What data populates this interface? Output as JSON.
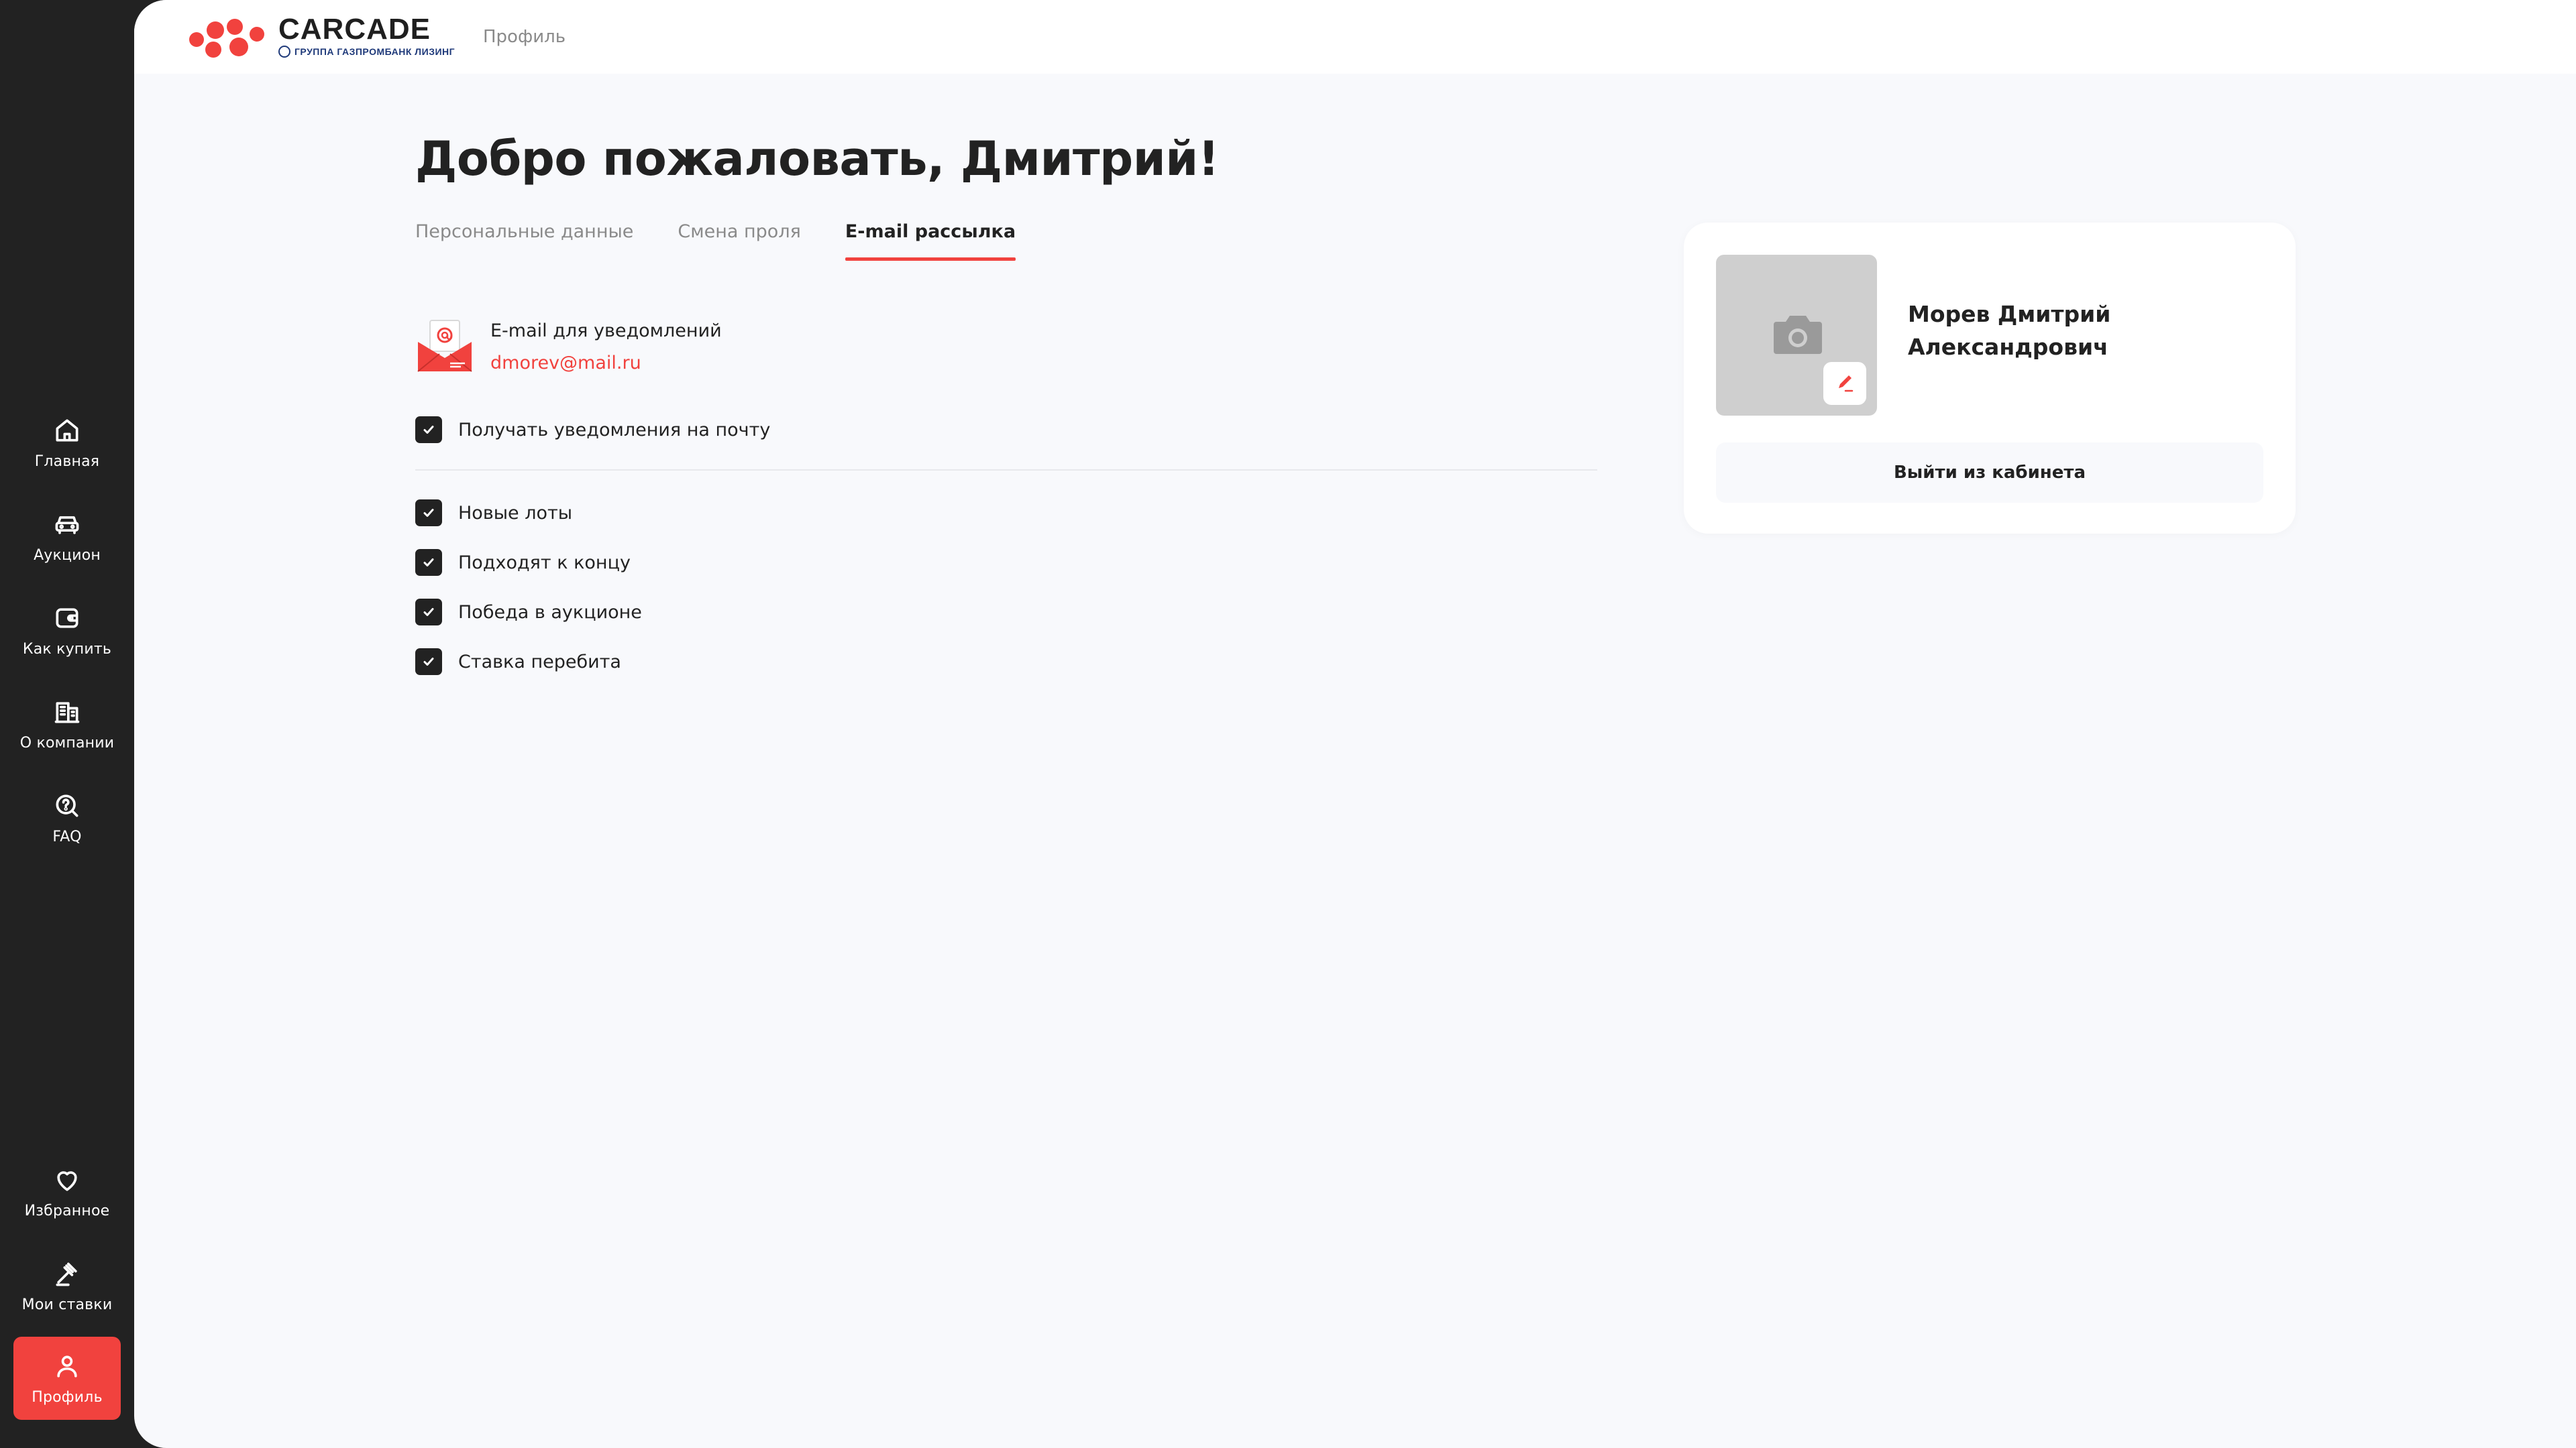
{
  "brand": {
    "name": "CARCADE",
    "subtitle": "ГРУППА ГАЗПРОМБАНК ЛИЗИНГ",
    "accent": "#F1423E",
    "dark": "#222222"
  },
  "header": {
    "breadcrumb": "Профиль"
  },
  "sidebar": {
    "items": [
      {
        "label": "Главная",
        "icon": "home-icon"
      },
      {
        "label": "Аукцион",
        "icon": "car-icon"
      },
      {
        "label": "Как купить",
        "icon": "wallet-icon"
      },
      {
        "label": "О компании",
        "icon": "building-icon"
      },
      {
        "label": "FAQ",
        "icon": "question-chat-icon"
      },
      {
        "label": "Избранное",
        "icon": "heart-icon"
      },
      {
        "label": "Мои ставки",
        "icon": "gavel-icon"
      },
      {
        "label": "Профиль",
        "icon": "user-icon",
        "active": true
      }
    ]
  },
  "main": {
    "title": "Добро пожаловать, Дмитрий!",
    "tabs": [
      {
        "label": "Персональные данные",
        "active": false
      },
      {
        "label": "Смена проля",
        "active": false
      },
      {
        "label": "E-mail рассылка",
        "active": true
      }
    ],
    "email": {
      "title": "E-mail для уведомлений",
      "value": "dmorev@mail.ru"
    },
    "master_checkbox": {
      "label": "Получать уведомления на почту",
      "checked": true
    },
    "checkboxes": [
      {
        "label": "Новые лоты",
        "checked": true
      },
      {
        "label": "Подходят к концу",
        "checked": true
      },
      {
        "label": "Победа в аукционе",
        "checked": true
      },
      {
        "label": "Ставка перебита",
        "checked": true
      }
    ]
  },
  "profile": {
    "name": "Морев Дмитрий Александрович",
    "logout_label": "Выйти из кабинета"
  }
}
